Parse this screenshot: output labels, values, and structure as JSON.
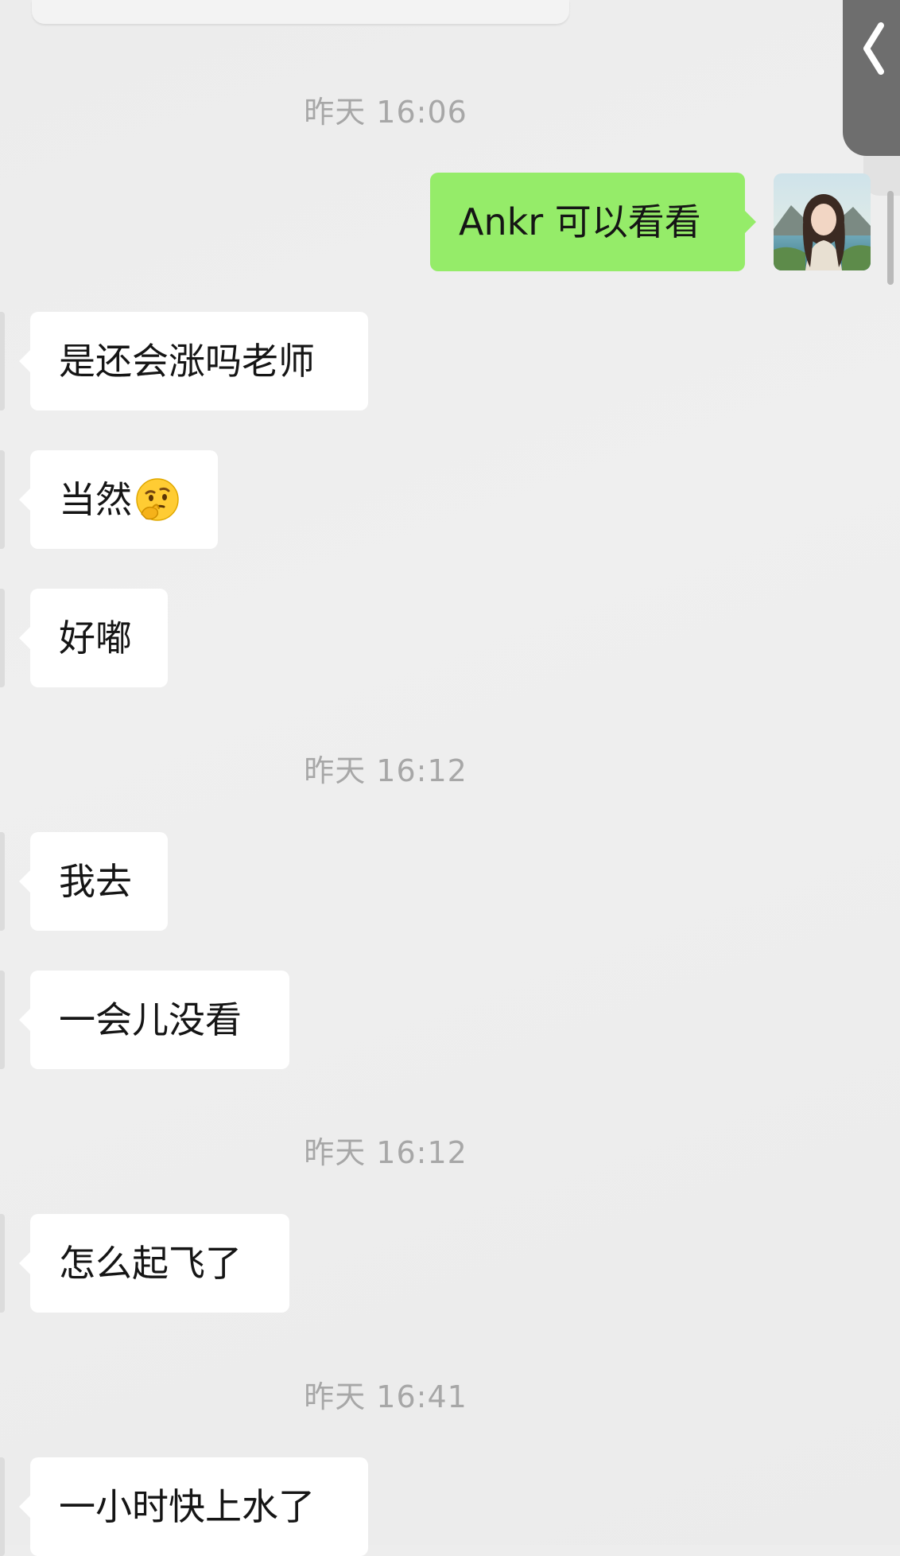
{
  "chat": {
    "timestamps": [
      "昨天 16:06",
      "昨天 16:12",
      "昨天 16:12",
      "昨天 16:41"
    ],
    "messages": [
      {
        "side": "right",
        "text": "Ankr 可以看看"
      },
      {
        "side": "left",
        "text": "是还会涨吗老师"
      },
      {
        "side": "left",
        "text": "当然",
        "emoji": "thinking-face-icon"
      },
      {
        "side": "left",
        "text": "好嘟"
      },
      {
        "side": "left",
        "text": "我去"
      },
      {
        "side": "left",
        "text": "一会儿没看"
      },
      {
        "side": "left",
        "text": "怎么起飞了"
      },
      {
        "side": "left",
        "text": "一小时快上水了"
      }
    ]
  },
  "colors": {
    "background": "#ededed",
    "bubble_incoming": "#ffffff",
    "bubble_outgoing": "#95ec69",
    "timestamp_text": "#a7a7a7"
  }
}
